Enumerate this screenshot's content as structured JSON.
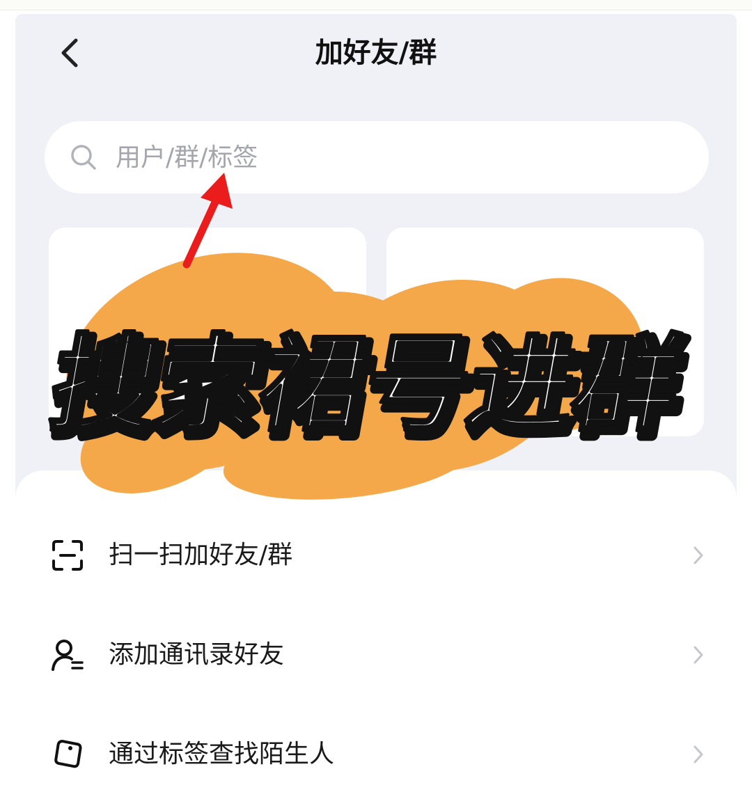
{
  "header": {
    "back_icon": "chevron-left-icon",
    "title": "加好友/群"
  },
  "search": {
    "icon": "search-icon",
    "placeholder": "用户/群/标签"
  },
  "menu": {
    "items": [
      {
        "label": "扫一扫加好友/群",
        "icon": "scan-icon"
      },
      {
        "label": "添加通讯录好友",
        "icon": "contacts-icon"
      },
      {
        "label": "通过标签查找陌生人",
        "icon": "tag-icon"
      }
    ],
    "chevron_icon": "chevron-right-icon"
  },
  "overlay": {
    "caption": "搜索裙号进群",
    "arrow_icon": "red-arrow-icon",
    "colors": {
      "scribble": "#f5a84a",
      "arrow": "#ea1c1c",
      "caption_fill": "#ffffff",
      "caption_outline": "#111111"
    }
  },
  "colors": {
    "background": "#eff1f6",
    "card": "#ffffff",
    "text_primary": "#111111",
    "text_placeholder": "#a3a6ad",
    "chevron": "#c4c6cc"
  }
}
